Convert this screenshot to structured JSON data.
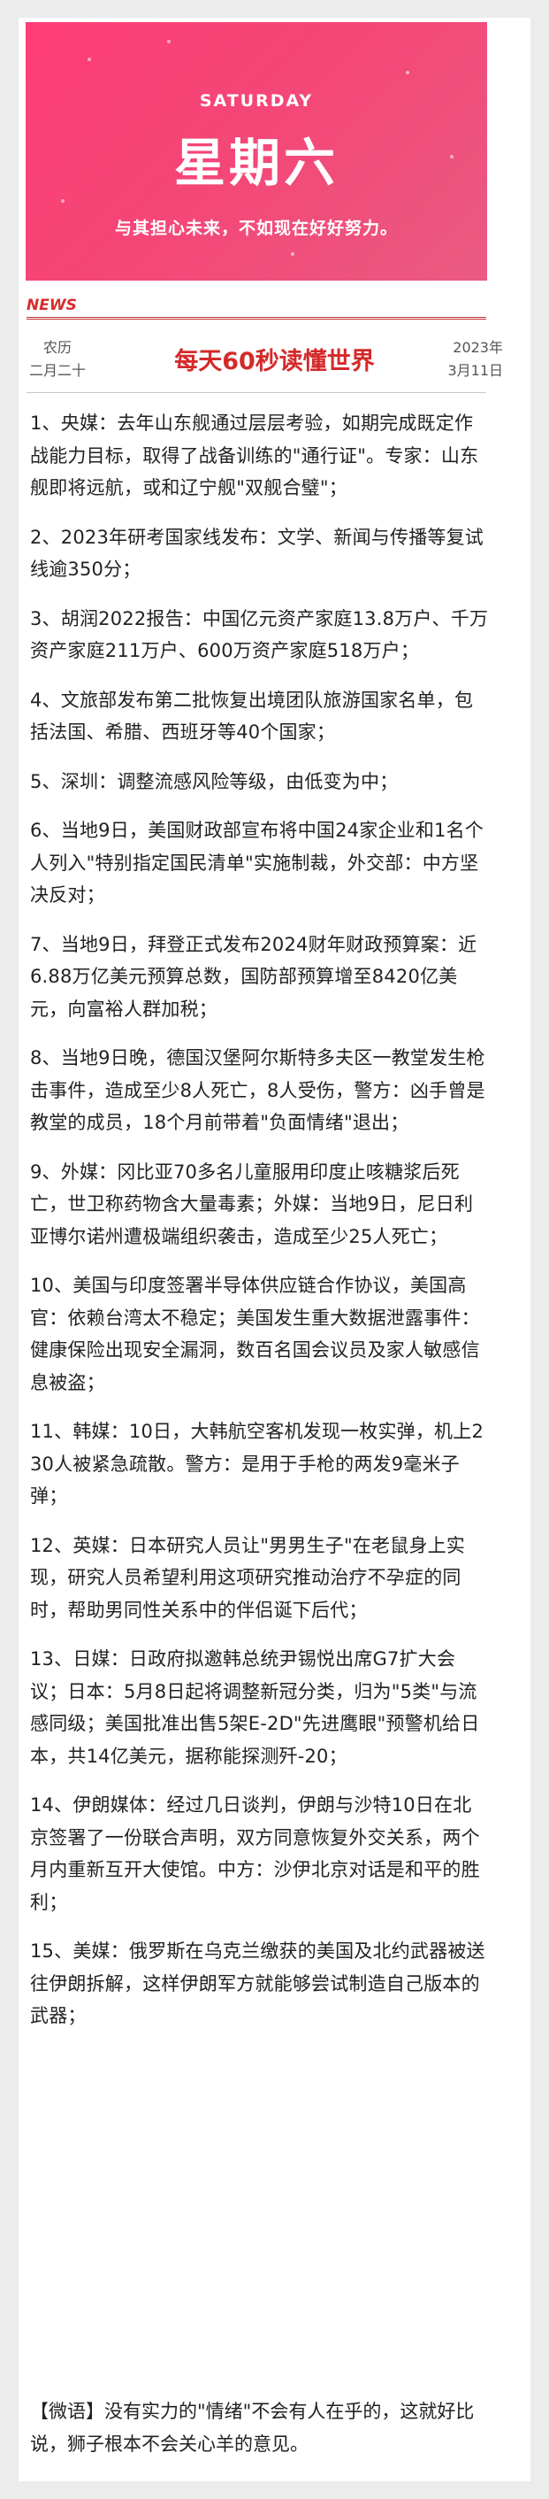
{
  "banner": {
    "weekday_en": "SATURDAY",
    "weekday_cn": "星期六",
    "motto": "与其担心未来，不如现在好好努力。"
  },
  "header": {
    "news_tag": "NEWS",
    "lunar_line1": "农历",
    "lunar_line2": "二月二十",
    "headline": "每天60秒读懂世界",
    "date_line1": "2023年",
    "date_line2": "3月11日"
  },
  "items": [
    "1、央媒：去年山东舰通过层层考验，如期完成既定作战能力目标，取得了战备训练的\"通行证\"。专家：山东舰即将远航，或和辽宁舰\"双舰合璧\"；",
    "2、2023年研考国家线发布：文学、新闻与传播等复试线逾350分；",
    "3、胡润2022报告：中国亿元资产家庭13.8万户、千万资产家庭211万户、600万资产家庭518万户；",
    "4、文旅部发布第二批恢复出境团队旅游国家名单，包括法国、希腊、西班牙等40个国家；",
    "5、深圳：调整流感风险等级，由低变为中；",
    "6、当地9日，美国财政部宣布将中国24家企业和1名个人列入\"特别指定国民清单\"实施制裁，外交部：中方坚决反对；",
    "7、当地9日，拜登正式发布2024财年财政预算案：近6.88万亿美元预算总数，国防部预算增至8420亿美元，向富裕人群加税；",
    "8、当地9日晚，德国汉堡阿尔斯特多夫区一教堂发生枪击事件，造成至少8人死亡，8人受伤，警方：凶手曾是教堂的成员，18个月前带着\"负面情绪\"退出；",
    "9、外媒：冈比亚70多名儿童服用印度止咳糖浆后死亡，世卫称药物含大量毒素；外媒：当地9日，尼日利亚博尔诺州遭极端组织袭击，造成至少25人死亡；",
    "10、美国与印度签署半导体供应链合作协议，美国高官：依赖台湾太不稳定；美国发生重大数据泄露事件：健康保险出现安全漏洞，数百名国会议员及家人敏感信息被盗；",
    "11、韩媒：10日，大韩航空客机发现一枚实弹，机上230人被紧急疏散。警方：是用于手枪的两发9毫米子弹；",
    "12、英媒：日本研究人员让\"男男生子\"在老鼠身上实现，研究人员希望利用这项研究推动治疗不孕症的同时，帮助男同性关系中的伴侣诞下后代；",
    "13、日媒：日政府拟邀韩总统尹锡悦出席G7扩大会议；日本：5月8日起将调整新冠分类，归为\"5类\"与流感同级；美国批准出售5架E-2D\"先进鹰眼\"预警机给日本，共14亿美元，据称能探测歼-20；",
    "14、伊朗媒体：经过几日谈判，伊朗与沙特10日在北京签署了一份联合声明，双方同意恢复外交关系，两个月内重新互开大使馆。中方：沙伊北京对话是和平的胜利；",
    "15、美媒：俄罗斯在乌克兰缴获的美国及北约武器被送往伊朗拆解，这样伊朗军方就能够尝试制造自己版本的武器；"
  ],
  "quote": "【微语】没有实力的\"情绪\"不会有人在乎的，这就好比说，狮子根本不会关心羊的意见。"
}
